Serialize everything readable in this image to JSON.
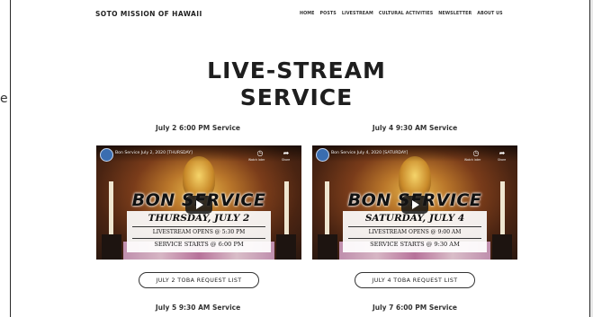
{
  "stray_char": "e",
  "site": {
    "title": "SOTO MISSION OF HAWAII"
  },
  "nav": [
    "HOME",
    "POSTS",
    "LIVESTREAM",
    "CULTURAL ACTIVITIES",
    "NEWSLETTER",
    "ABOUT US"
  ],
  "page": {
    "title_line1": "LIVE-STREAM",
    "title_line2": "SERVICE"
  },
  "services": [
    {
      "label": "July 2 6:00 PM Service",
      "video": {
        "title": "Bon Service July 2, 2020 [THURSDAY]",
        "banner": "BON SERVICE",
        "date": "THURSDAY, JULY 2",
        "line1": "LIVESTREAM OPENS @ 5:30 PM",
        "line2": "SERVICE STARTS @ 6:00 PM"
      },
      "button": "JULY 2 TOBA REQUEST LIST"
    },
    {
      "label": "July 4 9:30 AM Service",
      "video": {
        "title": "Bon Service July 4, 2020 [SATURDAY]",
        "banner": "BON SERVICE",
        "date": "SATURDAY, JULY 4",
        "line1": "LIVESTREAM OPENS @ 9:00 AM",
        "line2": "SERVICE STARTS @ 9:30 AM"
      },
      "button": "JULY 4 TOBA REQUEST LIST"
    }
  ],
  "next_services": [
    "July 5 9:30 AM Service",
    "July 7 6:00 PM Service"
  ],
  "video_controls": {
    "watch_later": "Watch later",
    "share": "Share"
  },
  "icons": {
    "play": "play-icon",
    "watch_later": "clock-icon",
    "share": "share-arrow-icon",
    "channel": "channel-avatar-icon"
  },
  "colors": {
    "text": "#222222",
    "background": "#ffffff",
    "frame": "#2a2a2a"
  }
}
